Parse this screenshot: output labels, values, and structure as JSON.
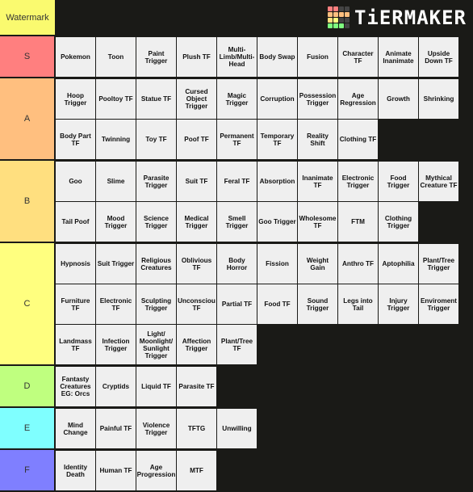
{
  "header": {
    "watermark": "Watermark",
    "logo_text": "TiERMAKER",
    "logo_grid": [
      "#ff7f7f",
      "#ff7f7f",
      "#444444",
      "#444444",
      "#ffbf7f",
      "#ffbf7f",
      "#ffbf7f",
      "#ffbf7f",
      "#ffdf7f",
      "#ffff7f",
      "#444444",
      "#444444",
      "#7fff7f",
      "#7fff7f",
      "#7fff7f",
      "#444444"
    ]
  },
  "tiers": [
    {
      "label": "S",
      "color": "#ff7f7f",
      "items": [
        "Pokemon",
        "Toon",
        "Paint Trigger",
        "Plush TF",
        "Multi-Limb/Multi-Head",
        "Body Swap",
        "Fusion",
        "Character TF",
        "Animate Inanimate",
        "Upside Down TF"
      ]
    },
    {
      "label": "A",
      "color": "#ffbf7f",
      "items": [
        "Hoop Trigger",
        "Pooltoy TF",
        "Statue TF",
        "Cursed Object Trigger",
        "Magic Trigger",
        "Corruption",
        "Possession Trigger",
        "Age Regression",
        "Growth",
        "Shrinking",
        "Body Part TF",
        "Twinning",
        "Toy TF",
        "Poof TF",
        "Permanent TF",
        "Temporary TF",
        "Reality Shift",
        "Clothing TF"
      ]
    },
    {
      "label": "B",
      "color": "#ffdf7f",
      "items": [
        "Goo",
        "Slime",
        "Parasite Trigger",
        "Suit TF",
        "Feral TF",
        "Absorption",
        "Inanimate TF",
        "Electronic Trigger",
        "Food Trigger",
        "Mythical Creature TF",
        "Tail Poof",
        "Mood Trigger",
        "Science Trigger",
        "Medical Trigger",
        "Smell Trigger",
        "Goo Trigger",
        "Wholesome TF",
        "FTM",
        "Clothing Trigger"
      ]
    },
    {
      "label": "C",
      "color": "#ffff7f",
      "items": [
        "Hypnosis",
        "Suit Trigger",
        "Religious Creatures",
        "Oblivious TF",
        "Body Horror",
        "Fission",
        "Weight Gain",
        "Anthro TF",
        "Aptophilia",
        "Plant/Tree Trigger",
        "Furniture TF",
        "Electronic TF",
        "Sculpting Trigger",
        "Unconsciou TF",
        "Partial TF",
        "Food TF",
        "Sound Trigger",
        "Legs into Tail",
        "Injury Trigger",
        "Enviroment Trigger",
        "Landmass TF",
        "Infection Trigger",
        "Light/ Moonlight/ Sunlight Trigger",
        "Affection Trigger",
        "Plant/Tree TF"
      ]
    },
    {
      "label": "D",
      "color": "#bfff7f",
      "items": [
        "Fantasty Creatures EG: Orcs",
        "Cryptids",
        "Liquid TF",
        "Parasite TF"
      ]
    },
    {
      "label": "E",
      "color": "#7fffff",
      "items": [
        "Mind Change",
        "Painful TF",
        "Violence Trigger",
        "TFTG",
        "Unwilling"
      ]
    },
    {
      "label": "F",
      "color": "#7f7fff",
      "items": [
        "Identity Death",
        "Human TF",
        "Age Progression",
        "MTF"
      ]
    }
  ]
}
